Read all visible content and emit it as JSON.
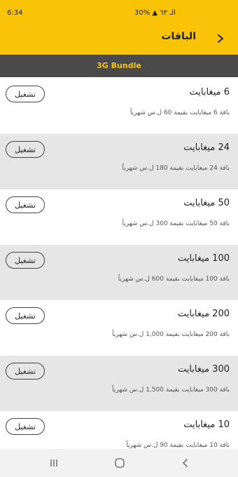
{
  "status_bar": {
    "time": "6:34",
    "right_text": "30% ▲ الـ ٦٣"
  },
  "header": {
    "title": "الباقات",
    "back_icon": "chevron-right-icon"
  },
  "section": {
    "title": "3G Bundle"
  },
  "bundles": [
    {
      "title": "6 ميغابايت",
      "description": "باقة 6 ميغابايت بقيمة 60 ل.س شهرياً",
      "button_label": "تشغيل"
    },
    {
      "title": "24 ميغابايت",
      "description": "باقة 24 ميغابايت بقيمة 180 ل.س شهرياً",
      "button_label": "تشغيل"
    },
    {
      "title": "50 ميغابايت",
      "description": "باقة 50 ميغابايت بقيمة 300 ل.س شهرياً",
      "button_label": "تشغيل"
    },
    {
      "title": "100 ميغابايت",
      "description": "باقة 100 ميغابايت بقيمة 600 ل.س شهرياً",
      "button_label": "تشغيل"
    },
    {
      "title": "200 ميغابايت",
      "description": "باقة 200 ميغابايت بقيمة 1,000 ل.س شهرياً",
      "button_label": "تشغيل"
    },
    {
      "title": "300 ميغابايت",
      "description": "باقة 300 ميغابايت بقيمة 1,500 ل.س شهرياً",
      "button_label": "تشغيل"
    },
    {
      "title": "10 ميغابايت",
      "description": "باقة 10 ميغابايت بقيمة 90 ل.س شهرياً",
      "button_label": "تشغيل"
    }
  ],
  "colors": {
    "accent": "#f9c407",
    "section_bar": "#4a4a4a",
    "row_shade": "#e6e6e6"
  },
  "nav": {
    "recents_icon": "recents-icon",
    "home_icon": "home-icon",
    "back_icon": "back-icon"
  }
}
